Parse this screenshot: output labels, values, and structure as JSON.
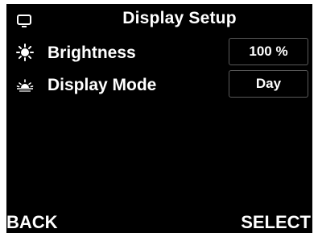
{
  "header": {
    "title": "Display Setup",
    "icon": "monitor-icon"
  },
  "settings": [
    {
      "icon": "sun-icon",
      "label": "Brightness",
      "value": "100 %"
    },
    {
      "icon": "sunset-icon",
      "label": "Display Mode",
      "value": "Day"
    }
  ],
  "softkeys": {
    "left": "BACK",
    "right": "SELECT"
  },
  "colors": {
    "background": "#000000",
    "text": "#ffffff",
    "box_border": "#5a5a5a"
  }
}
